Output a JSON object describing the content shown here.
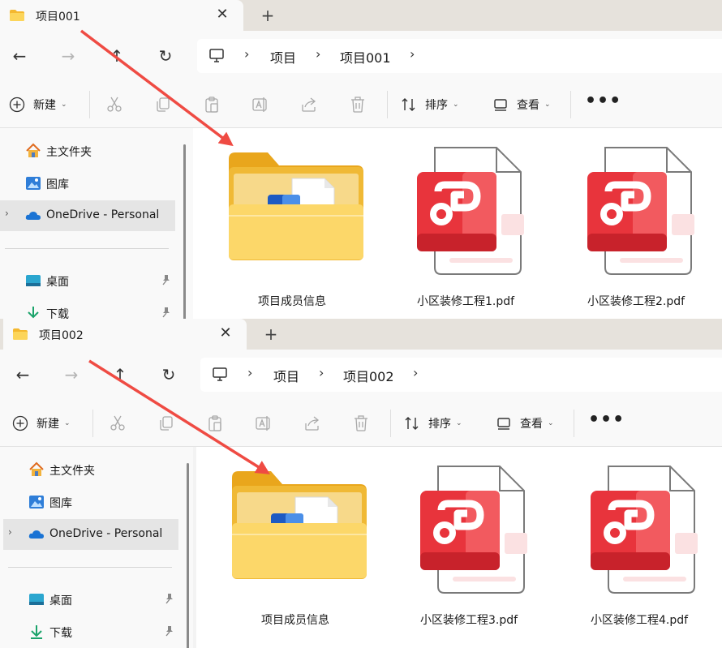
{
  "windows": [
    {
      "tab_title": "项目001",
      "breadcrumbs": [
        "项目",
        "项目001"
      ],
      "files": [
        {
          "name": "项目成员信息",
          "type": "folder"
        },
        {
          "name": "小区装修工程1.pdf",
          "type": "pdf"
        },
        {
          "name": "小区装修工程2.pdf",
          "type": "pdf"
        }
      ]
    },
    {
      "tab_title": "项目002",
      "breadcrumbs": [
        "项目",
        "项目002"
      ],
      "files": [
        {
          "name": "项目成员信息",
          "type": "folder"
        },
        {
          "name": "小区装修工程3.pdf",
          "type": "pdf"
        },
        {
          "name": "小区装修工程4.pdf",
          "type": "pdf"
        }
      ]
    }
  ],
  "toolbar": {
    "new_label": "新建",
    "sort_label": "排序",
    "view_label": "查看",
    "more_label": "•••"
  },
  "tab": {
    "close_glyph": "✕",
    "new_tab_glyph": "+"
  },
  "nav": {
    "back": "←",
    "forward": "→",
    "up": "↑",
    "refresh": "↻"
  },
  "sidebar": {
    "home": "主文件夹",
    "gallery": "图库",
    "onedrive": "OneDrive - Personal",
    "desktop": "桌面",
    "downloads": "下载"
  },
  "colors": {
    "arrow": "#ef4b43",
    "pdf_red": "#e8343c",
    "folder_yellow": "#f6c543"
  }
}
